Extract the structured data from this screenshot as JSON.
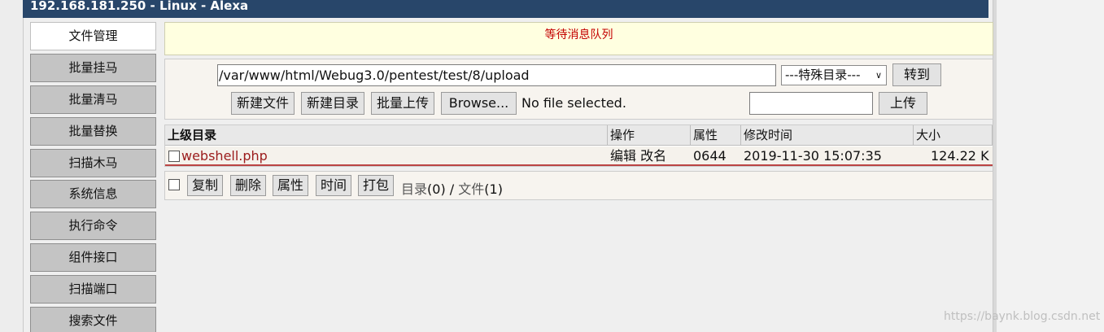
{
  "window": {
    "title": "192.168.181.250 - Linux - Alexa"
  },
  "sidebar": {
    "items": [
      {
        "label": "文件管理",
        "active": true
      },
      {
        "label": "批量挂马"
      },
      {
        "label": "批量清马"
      },
      {
        "label": "批量替换"
      },
      {
        "label": "扫描木马"
      },
      {
        "label": "系统信息"
      },
      {
        "label": "执行命令"
      },
      {
        "label": "组件接口"
      },
      {
        "label": "扫描端口"
      },
      {
        "label": "搜索文件"
      }
    ]
  },
  "message": "等待消息队列",
  "path": {
    "value": "/var/www/html/Webug3.0/pentest/test/8/upload",
    "special_dir": "---特殊目录---",
    "goto_label": "转到"
  },
  "toolbar": {
    "new_file": "新建文件",
    "new_dir": "新建目录",
    "batch_upload": "批量上传",
    "browse": "Browse...",
    "no_file": "No file selected.",
    "upload": "上传"
  },
  "table": {
    "headers": {
      "name": "上级目录",
      "ops": "操作",
      "attr": "属性",
      "mtime": "修改时间",
      "size": "大小"
    },
    "rows": [
      {
        "name": "webshell.php",
        "ops": "编辑 改名",
        "attr": "0644",
        "mtime": "2019-11-30 15:07:35",
        "size": "124.22 K"
      }
    ]
  },
  "actions": {
    "copy": "复制",
    "delete": "删除",
    "attr": "属性",
    "time": "时间",
    "pack": "打包",
    "dir_label": "目录",
    "dir_count": "(0)",
    "sep": "/",
    "file_label": "文件",
    "file_count": "(1)"
  },
  "watermark": "https://baynk.blog.csdn.net"
}
